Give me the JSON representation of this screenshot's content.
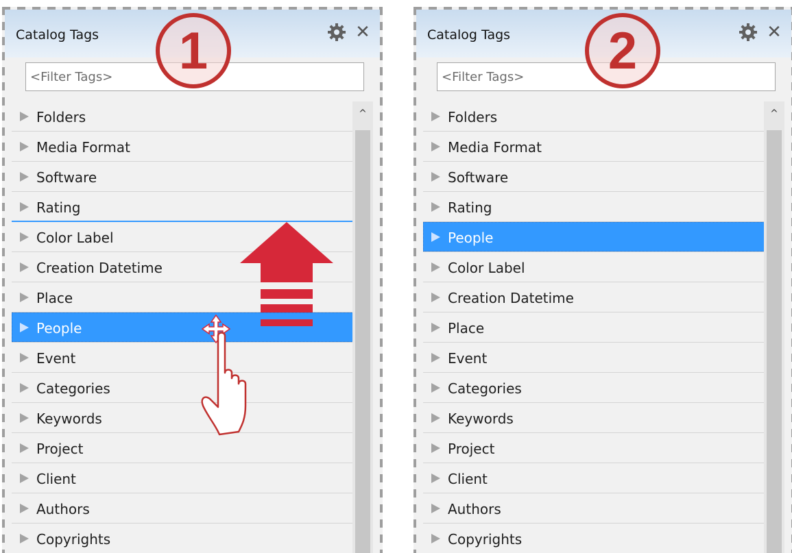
{
  "panels": [
    {
      "title": "Catalog Tags",
      "filter_placeholder": "<Filter Tags>",
      "step_number": "1",
      "items": [
        {
          "label": "Folders"
        },
        {
          "label": "Media Format"
        },
        {
          "label": "Software"
        },
        {
          "label": "Rating"
        },
        {
          "label": "Color Label"
        },
        {
          "label": "Creation Datetime"
        },
        {
          "label": "Place"
        },
        {
          "label": "People"
        },
        {
          "label": "Event"
        },
        {
          "label": "Categories"
        },
        {
          "label": "Keywords"
        },
        {
          "label": "Project"
        },
        {
          "label": "Client"
        },
        {
          "label": "Authors"
        },
        {
          "label": "Copyrights"
        }
      ],
      "selected_item": "People"
    },
    {
      "title": "Catalog Tags",
      "filter_placeholder": "<Filter Tags>",
      "step_number": "2",
      "items": [
        {
          "label": "Folders"
        },
        {
          "label": "Media Format"
        },
        {
          "label": "Software"
        },
        {
          "label": "Rating"
        },
        {
          "label": "People"
        },
        {
          "label": "Color Label"
        },
        {
          "label": "Creation Datetime"
        },
        {
          "label": "Place"
        },
        {
          "label": "Event"
        },
        {
          "label": "Categories"
        },
        {
          "label": "Keywords"
        },
        {
          "label": "Project"
        },
        {
          "label": "Client"
        },
        {
          "label": "Authors"
        },
        {
          "label": "Copyrights"
        }
      ],
      "selected_item": "People"
    }
  ],
  "icons": {
    "settings": "gear-icon",
    "close": "close-icon",
    "tree_expand": "triangle-right-icon",
    "scroll_up": "chevron-up-icon",
    "drag_hand": "hand-pointer-icon",
    "move": "move-arrows-icon",
    "drag_direction": "arrow-up-icon"
  },
  "colors": {
    "selection": "#3399ff",
    "step_badge": "#c0312f",
    "drag_arrow": "#d62839",
    "titlebar": "#c9dcef"
  },
  "glyphs": {
    "close": "✕",
    "scroll_up": "^"
  }
}
